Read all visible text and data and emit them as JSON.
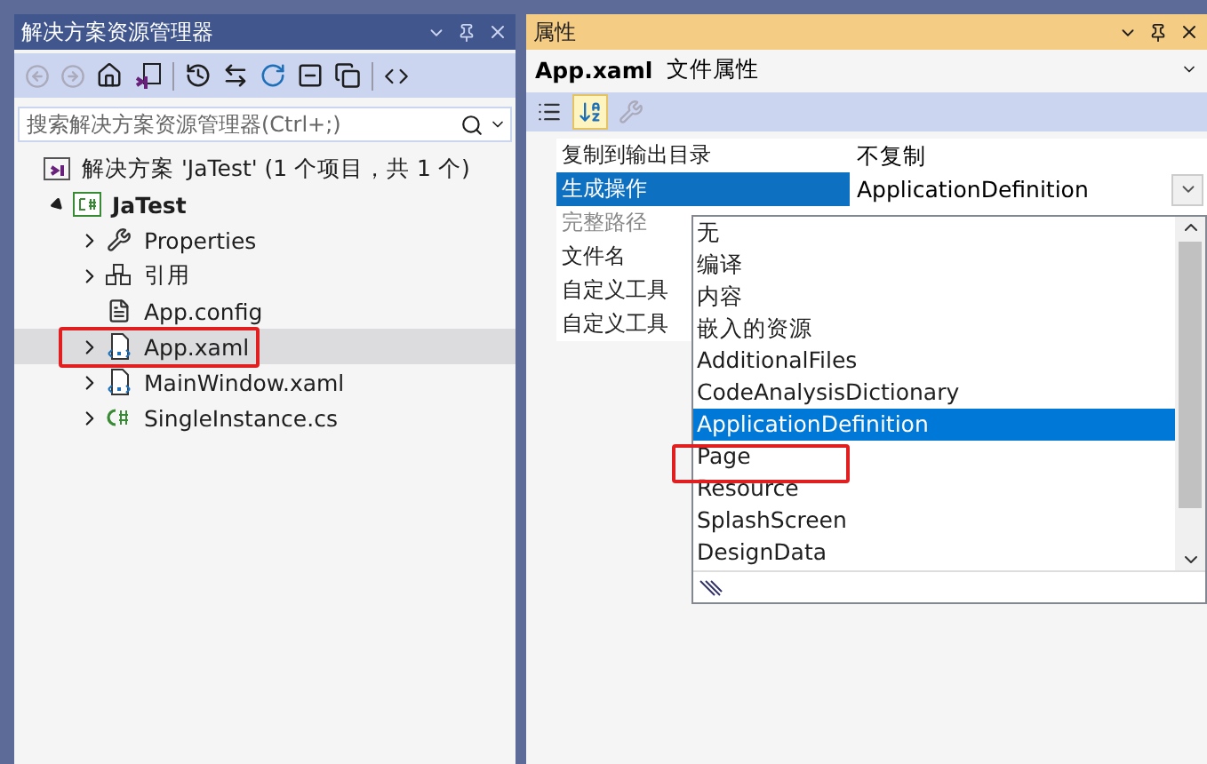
{
  "solution_explorer": {
    "title": "解决方案资源管理器",
    "active": false,
    "search": {
      "placeholder": "搜索解决方案资源管理器(Ctrl+;)"
    },
    "tree": [
      {
        "kind": "solution",
        "label": "解决方案 'JaTest' (1 个项目，共 1 个)",
        "selected": false,
        "children": [
          {
            "kind": "project",
            "label": "JaTest",
            "expanded": true,
            "selected": false,
            "children": [
              {
                "kind": "properties",
                "label": "Properties",
                "expanded": false,
                "selected": false
              },
              {
                "kind": "references",
                "label": "引用",
                "expanded": false,
                "selected": false
              },
              {
                "kind": "config",
                "label": "App.config",
                "selected": false
              },
              {
                "kind": "xaml",
                "label": "App.xaml",
                "expanded": false,
                "selected": true,
                "annotated": true
              },
              {
                "kind": "xaml",
                "label": "MainWindow.xaml",
                "expanded": false,
                "selected": false
              },
              {
                "kind": "cs",
                "label": "SingleInstance.cs",
                "expanded": false,
                "selected": false
              }
            ]
          }
        ]
      }
    ]
  },
  "properties": {
    "title": "属性",
    "active": true,
    "object_name": "App.xaml",
    "object_type": "文件属性",
    "view_buttons": [
      {
        "kind": "categorized",
        "selected": false
      },
      {
        "kind": "alphabetical",
        "selected": true
      },
      {
        "kind": "property-pages",
        "disabled": true,
        "selected": false
      }
    ],
    "rows": [
      {
        "name": "复制到输出目录",
        "value": "不复制",
        "selected": false,
        "disabled": false
      },
      {
        "name": "生成操作",
        "value": "ApplicationDefinition",
        "selected": true,
        "disabled": false
      },
      {
        "name": "完整路径",
        "selected": false,
        "disabled": true
      },
      {
        "name": "文件名",
        "selected": false,
        "disabled": false
      },
      {
        "name": "自定义工具",
        "selected": false,
        "disabled": false
      },
      {
        "name": "自定义工具",
        "selected": false,
        "disabled": false
      }
    ],
    "dropdown": {
      "items": [
        {
          "label": "无",
          "selected": false
        },
        {
          "label": "编译",
          "selected": false
        },
        {
          "label": "内容",
          "selected": false
        },
        {
          "label": "嵌入的资源",
          "selected": false
        },
        {
          "label": "AdditionalFiles",
          "selected": false
        },
        {
          "label": "CodeAnalysisDictionary",
          "selected": false
        },
        {
          "label": "ApplicationDefinition",
          "selected": true
        },
        {
          "label": "Page",
          "selected": false,
          "annotated": true
        },
        {
          "label": "Resource",
          "selected": false
        },
        {
          "label": "SplashScreen",
          "selected": false
        },
        {
          "label": "DesignData",
          "selected": false
        }
      ]
    }
  }
}
